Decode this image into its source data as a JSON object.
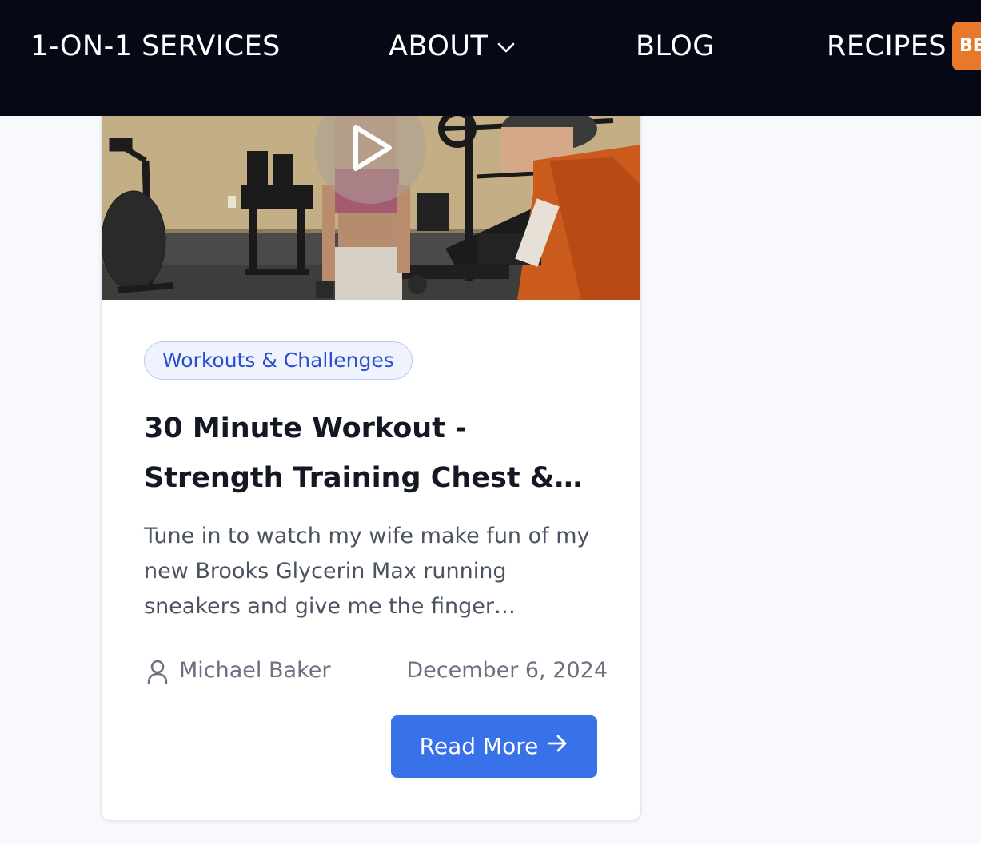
{
  "nav": {
    "items": [
      {
        "label": "1-ON-1 SERVICES"
      },
      {
        "label": "ABOUT",
        "icon": "chevron-down-icon"
      },
      {
        "label": "BLOG"
      },
      {
        "label": "RECIPES"
      }
    ],
    "badge": "BE",
    "colors": {
      "background": "#060815",
      "badge": "#e8792b"
    }
  },
  "card": {
    "thumbnail": {
      "icon": "play-icon"
    },
    "category": "Workouts & Challenges",
    "title": "30 Minute Workout - Strength Training Chest &…",
    "excerpt": "Tune in to watch my wife make fun of my new Brooks Glycerin Max running sneakers and give me the finger…",
    "author": "Michael Baker",
    "author_icon": "user-icon",
    "date": "December 6, 2024",
    "read_more": "Read More",
    "read_more_icon": "arrow-right-icon",
    "colors": {
      "button": "#3871e8",
      "tag_text": "#2d4dd0"
    }
  }
}
